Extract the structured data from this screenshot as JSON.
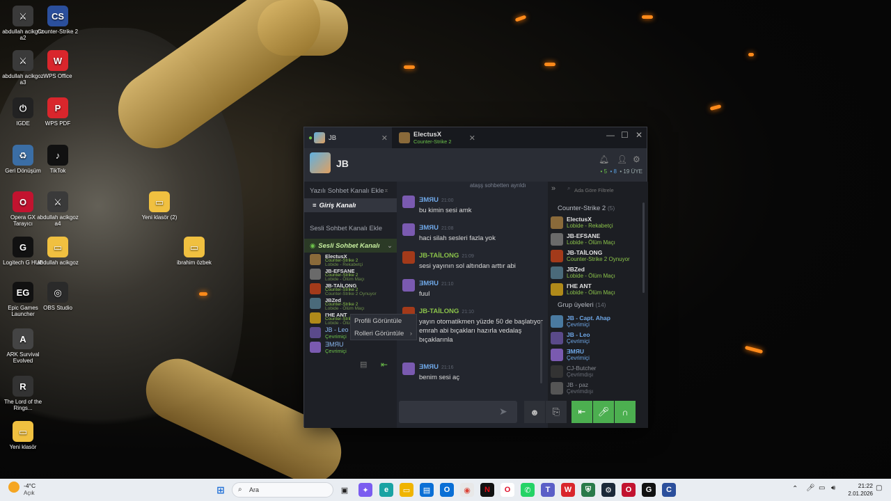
{
  "desktop": {
    "icons": [
      {
        "label": "abdullah acikgoz a2",
        "color": "#3a3a3a",
        "glyph": "⚔"
      },
      {
        "label": "Counter-Strike 2",
        "color": "#2b4f9c",
        "glyph": "CS"
      },
      {
        "label": "abdullah acikgoz a3",
        "color": "#3a3a3a",
        "glyph": "⚔"
      },
      {
        "label": "WPS Office",
        "color": "#d9262c",
        "glyph": "W"
      },
      {
        "label": "IGDE",
        "color": "#222222",
        "glyph": "⏻"
      },
      {
        "label": "WPS PDF",
        "color": "#d9262c",
        "glyph": "P"
      },
      {
        "label": "Geri Dönüşüm",
        "color": "#3b6ea5",
        "glyph": "♻"
      },
      {
        "label": "TikTok",
        "color": "#111111",
        "glyph": "♪"
      },
      {
        "label": "Opera GX Tarayıcı",
        "color": "#c2132f",
        "glyph": "O"
      },
      {
        "label": "abdullah acikgoz a4",
        "color": "#3a3a3a",
        "glyph": "⚔"
      },
      {
        "label": "Yeni klasör (2)",
        "color": "#f0c040",
        "glyph": "▭"
      },
      {
        "label": "Logitech G HUB",
        "color": "#111111",
        "glyph": "G"
      },
      {
        "label": "abdullah acikgoz",
        "color": "#f0c040",
        "glyph": "▭"
      },
      {
        "label": "ibrahim özbek",
        "color": "#f0c040",
        "glyph": "▭"
      },
      {
        "label": "Epic Games Launcher",
        "color": "#111111",
        "glyph": "EG"
      },
      {
        "label": "OBS Studio",
        "color": "#2a2a2a",
        "glyph": "◎"
      },
      {
        "label": "ARK Survival Evolved",
        "color": "#444444",
        "glyph": "A"
      },
      {
        "label": "The Lord of the Rings...",
        "color": "#333333",
        "glyph": "R"
      },
      {
        "label": "Yeni klasör",
        "color": "#f0c040",
        "glyph": "▭"
      }
    ]
  },
  "chat": {
    "tabs": [
      {
        "name": "JB",
        "sub": ""
      },
      {
        "name": "ElectusX",
        "sub": "Counter-Strike 2"
      }
    ],
    "group_name": "JB",
    "stats": {
      "online": "5",
      "ingame": "8",
      "members": "19 ÜYE"
    },
    "left": {
      "text_channel_add": "Yazılı Sohbet Kanalı Ekle",
      "text_channel": "Giriş Kanalı",
      "voice_channel_add": "Sesli Sohbet Kanalı Ekle",
      "voice_channel": "Sesli Sohbet Kanalı",
      "voice_members": [
        {
          "name": "ElectusX",
          "game": "Counter-Strike 2",
          "status": "Lobide - Rekabetçi",
          "color": "#8a6a3a"
        },
        {
          "name": "JB-EFSANE",
          "game": "Counter-Strike 2",
          "status": "Lobide - Ölüm Maçı",
          "color": "#6a6a6a"
        },
        {
          "name": "JB-TAİLONG",
          "game": "Counter-Strike 2",
          "status": "Counter-Strike 2 Oynuyor",
          "color": "#a33a1a"
        },
        {
          "name": "JBZed",
          "game": "Counter-Strike 2",
          "status": "Lobide - Ölüm Maçı",
          "color": "#4a6a7a"
        },
        {
          "name": "I'HE ANT",
          "game": "Counter-Strike 2",
          "status": "Lobide - Ölüm Maçı",
          "color": "#b08a1a"
        }
      ],
      "online_members": [
        {
          "name": "JB - Leo",
          "status": "Çevrimiçi",
          "color": "#5a4a8a"
        },
        {
          "name": "ƎMЯU",
          "status": "Çevrimiçi",
          "color": "#7a5ab0"
        }
      ]
    },
    "context_menu": {
      "item1": "Profili Görüntüle",
      "item2": "Rolleri Görüntüle"
    },
    "system_message": "ataşş sohbetten ayrıldı",
    "messages": [
      {
        "user": "ƎMЯU",
        "time": "21:00",
        "text": "bu kimin sesi amk",
        "color": "#7a5ab0",
        "green": false
      },
      {
        "user": "ƎMЯU",
        "time": "21:08",
        "text": "haci silah sesleri fazla yok",
        "color": "#7a5ab0",
        "green": false
      },
      {
        "user": "JB-TAİLONG",
        "time": "21:09",
        "text": "sesi yayının sol altından arttır abi",
        "color": "#a33a1a",
        "green": true
      },
      {
        "user": "ƎMЯU",
        "time": "21:10",
        "text": "fuul",
        "color": "#7a5ab0",
        "green": false
      },
      {
        "user": "JB-TAİLONG",
        "time": "21:10",
        "text": "yayın otomatikmen yüzde 50 de başlatıyor emrah abi bıçakları hazırla vedalaş bıçaklarınla",
        "color": "#a33a1a",
        "green": true
      },
      {
        "user": "ƎMЯU",
        "time": "21:16",
        "text": "benim sesi aç",
        "color": "#7a5ab0",
        "green": false
      }
    ],
    "right": {
      "search_placeholder": "Ada Göre Filtrele",
      "section1": "Counter-Strike 2",
      "section1_count": "(5)",
      "ingame": [
        {
          "name": "ElectusX",
          "status": "Lobide - Rekabetçi",
          "color": "#8a6a3a"
        },
        {
          "name": "JB-EFSANE",
          "status": "Lobide - Ölüm Maçı",
          "color": "#6a6a6a"
        },
        {
          "name": "JB-TAİLONG",
          "status": "Counter-Strike 2 Oynuyor",
          "color": "#a33a1a"
        },
        {
          "name": "JBZed",
          "status": "Lobide - Ölüm Maçı",
          "color": "#4a6a7a"
        },
        {
          "name": "I'HE ANT",
          "status": "Lobide - Ölüm Maçı",
          "color": "#b08a1a"
        }
      ],
      "section2": "Grup üyeleri",
      "section2_count": "(14)",
      "members": [
        {
          "name": "JB - Capt. Ahap",
          "status": "Çevrimiçi",
          "color": "#4a7aa0",
          "kind": "blue"
        },
        {
          "name": "JB - Leo",
          "status": "Çevrimiçi",
          "color": "#5a4a8a",
          "kind": "blue"
        },
        {
          "name": "ƎMЯU",
          "status": "Çevrimiçi",
          "color": "#7a5ab0",
          "kind": "blue"
        },
        {
          "name": "CJ-Butcher",
          "status": "Çevrimdışı",
          "color": "#333333",
          "kind": "off"
        },
        {
          "name": "JB - paz",
          "status": "Çevrimdışı",
          "color": "#555555",
          "kind": "off"
        }
      ]
    }
  },
  "taskbar": {
    "weather_temp": "-4°C",
    "weather_desc": "Açık",
    "search_label": "Ara",
    "time": "21:22",
    "date": "2.01.2026"
  }
}
